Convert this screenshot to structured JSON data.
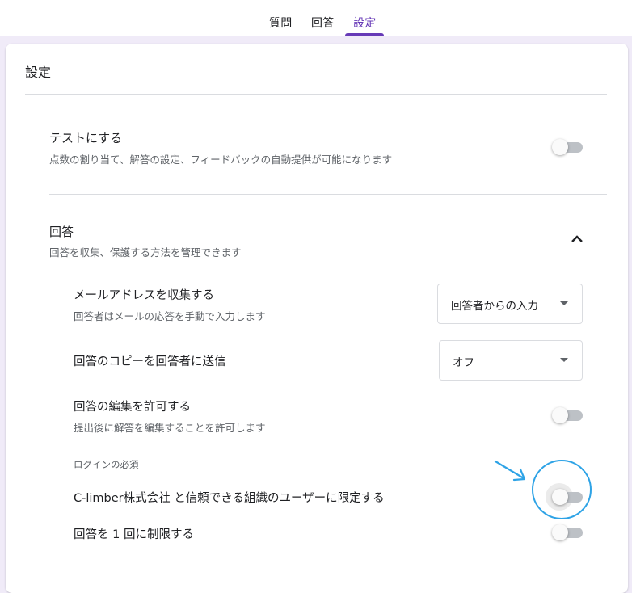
{
  "tabs": [
    {
      "label": "質問"
    },
    {
      "label": "回答"
    },
    {
      "label": "設定"
    }
  ],
  "settings": {
    "title": "設定",
    "quiz": {
      "title": "テストにする",
      "description": "点数の割り当て、解答の設定、フィードバックの自動提供が可能になります",
      "enabled": false
    },
    "responses": {
      "title": "回答",
      "description": "回答を収集、保護する方法を管理できます",
      "expanded": true,
      "collect_email": {
        "title": "メールアドレスを収集する",
        "description": "回答者はメールの応答を手動で入力します",
        "selected": "回答者からの入力"
      },
      "send_copy": {
        "title": "回答のコピーを回答者に送信",
        "selected": "オフ"
      },
      "allow_edit": {
        "title": "回答の編集を許可する",
        "description": "提出後に解答を編集することを許可します",
        "enabled": false
      },
      "login_section_label": "ログインの必須",
      "restrict_org": {
        "title": "C-limber株式会社 と信頼できる組織のユーザーに限定する",
        "enabled": false
      },
      "limit_one": {
        "title": "回答を 1 回に制限する",
        "enabled": false
      }
    }
  },
  "annotation": {
    "color": "#2ea3e6"
  },
  "colors": {
    "accent": "#673ab7",
    "background": "#f0ebf8",
    "toggle_off_track": "#bdc1c6",
    "divider": "#dadce0"
  },
  "icons": {
    "expand": "chevron-up-icon",
    "dropdown": "caret-down-icon",
    "annotation_arrow": "arrow-icon"
  }
}
